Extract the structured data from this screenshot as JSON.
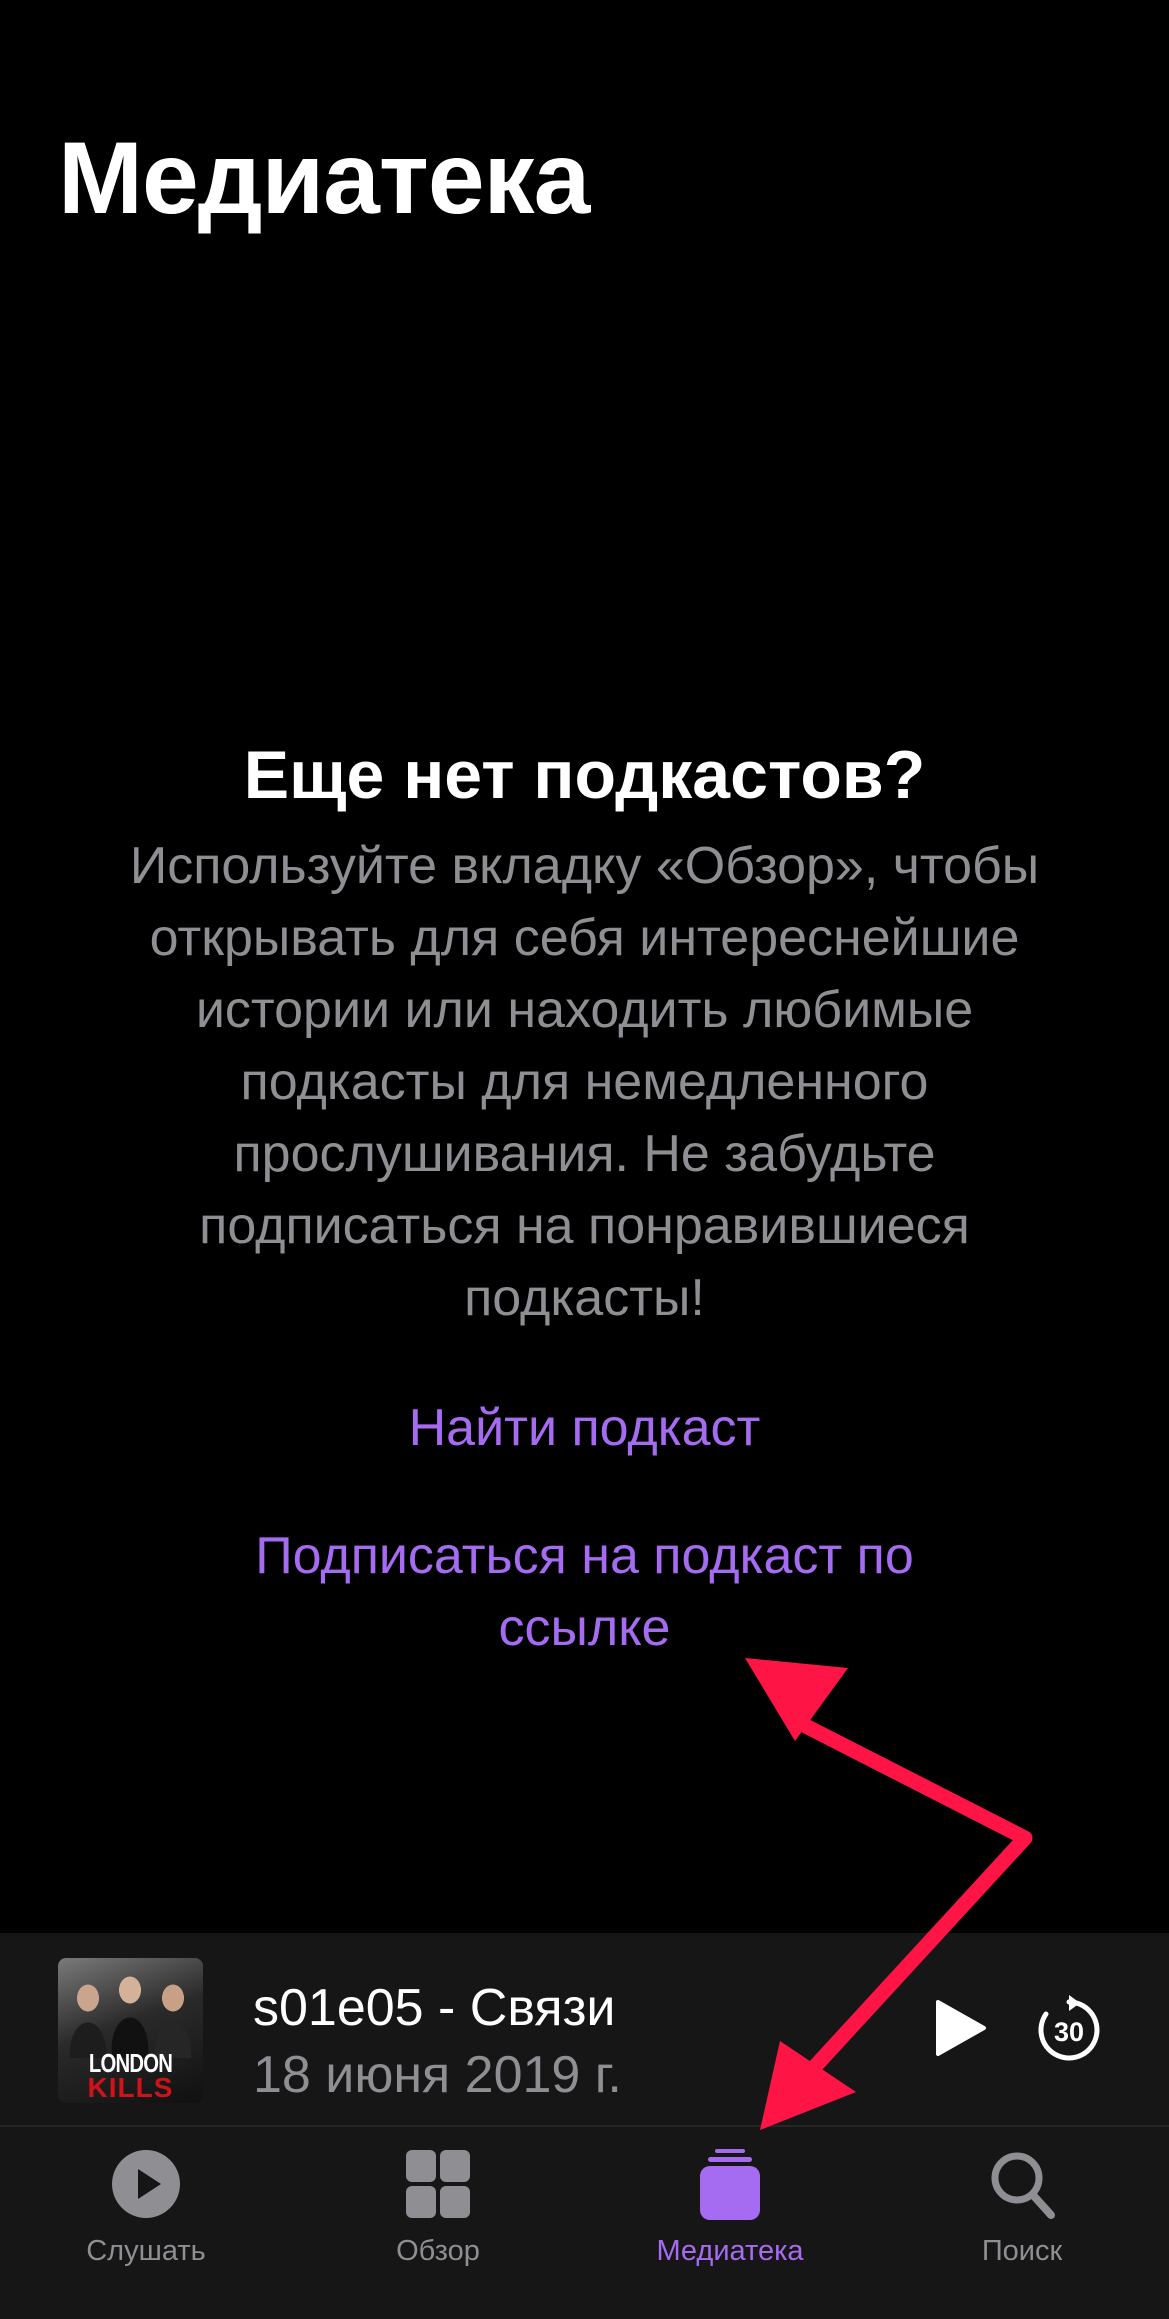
{
  "header": {
    "title": "Медиатека"
  },
  "empty_state": {
    "heading": "Еще нет подкастов?",
    "body": "Используйте вкладку «Обзор», чтобы открывать для себя интереснейшие истории или находить любимые подкасты для немедленного прослушивания. Не забудьте подписаться на понравившиеся подкасты!",
    "find_link": "Найти подкаст",
    "subscribe_link": "Подписаться на подкаст по ссылке"
  },
  "mini_player": {
    "artwork_text_line1": "LONDON",
    "artwork_text_line2": "KILLS",
    "episode_title": "s01e05 - Связи",
    "episode_date": "18 июня 2019 г.",
    "skip_seconds": "30"
  },
  "tab_bar": {
    "tabs": [
      {
        "label": "Слушать",
        "icon": "play-circle-icon",
        "active": false
      },
      {
        "label": "Обзор",
        "icon": "grid-icon",
        "active": false
      },
      {
        "label": "Медиатека",
        "icon": "library-stack-icon",
        "active": true
      },
      {
        "label": "Поиск",
        "icon": "search-icon",
        "active": false
      }
    ]
  },
  "colors": {
    "accent": "#a56bf0",
    "annotation_arrow": "#ff1446",
    "inactive": "#8e8e93"
  }
}
